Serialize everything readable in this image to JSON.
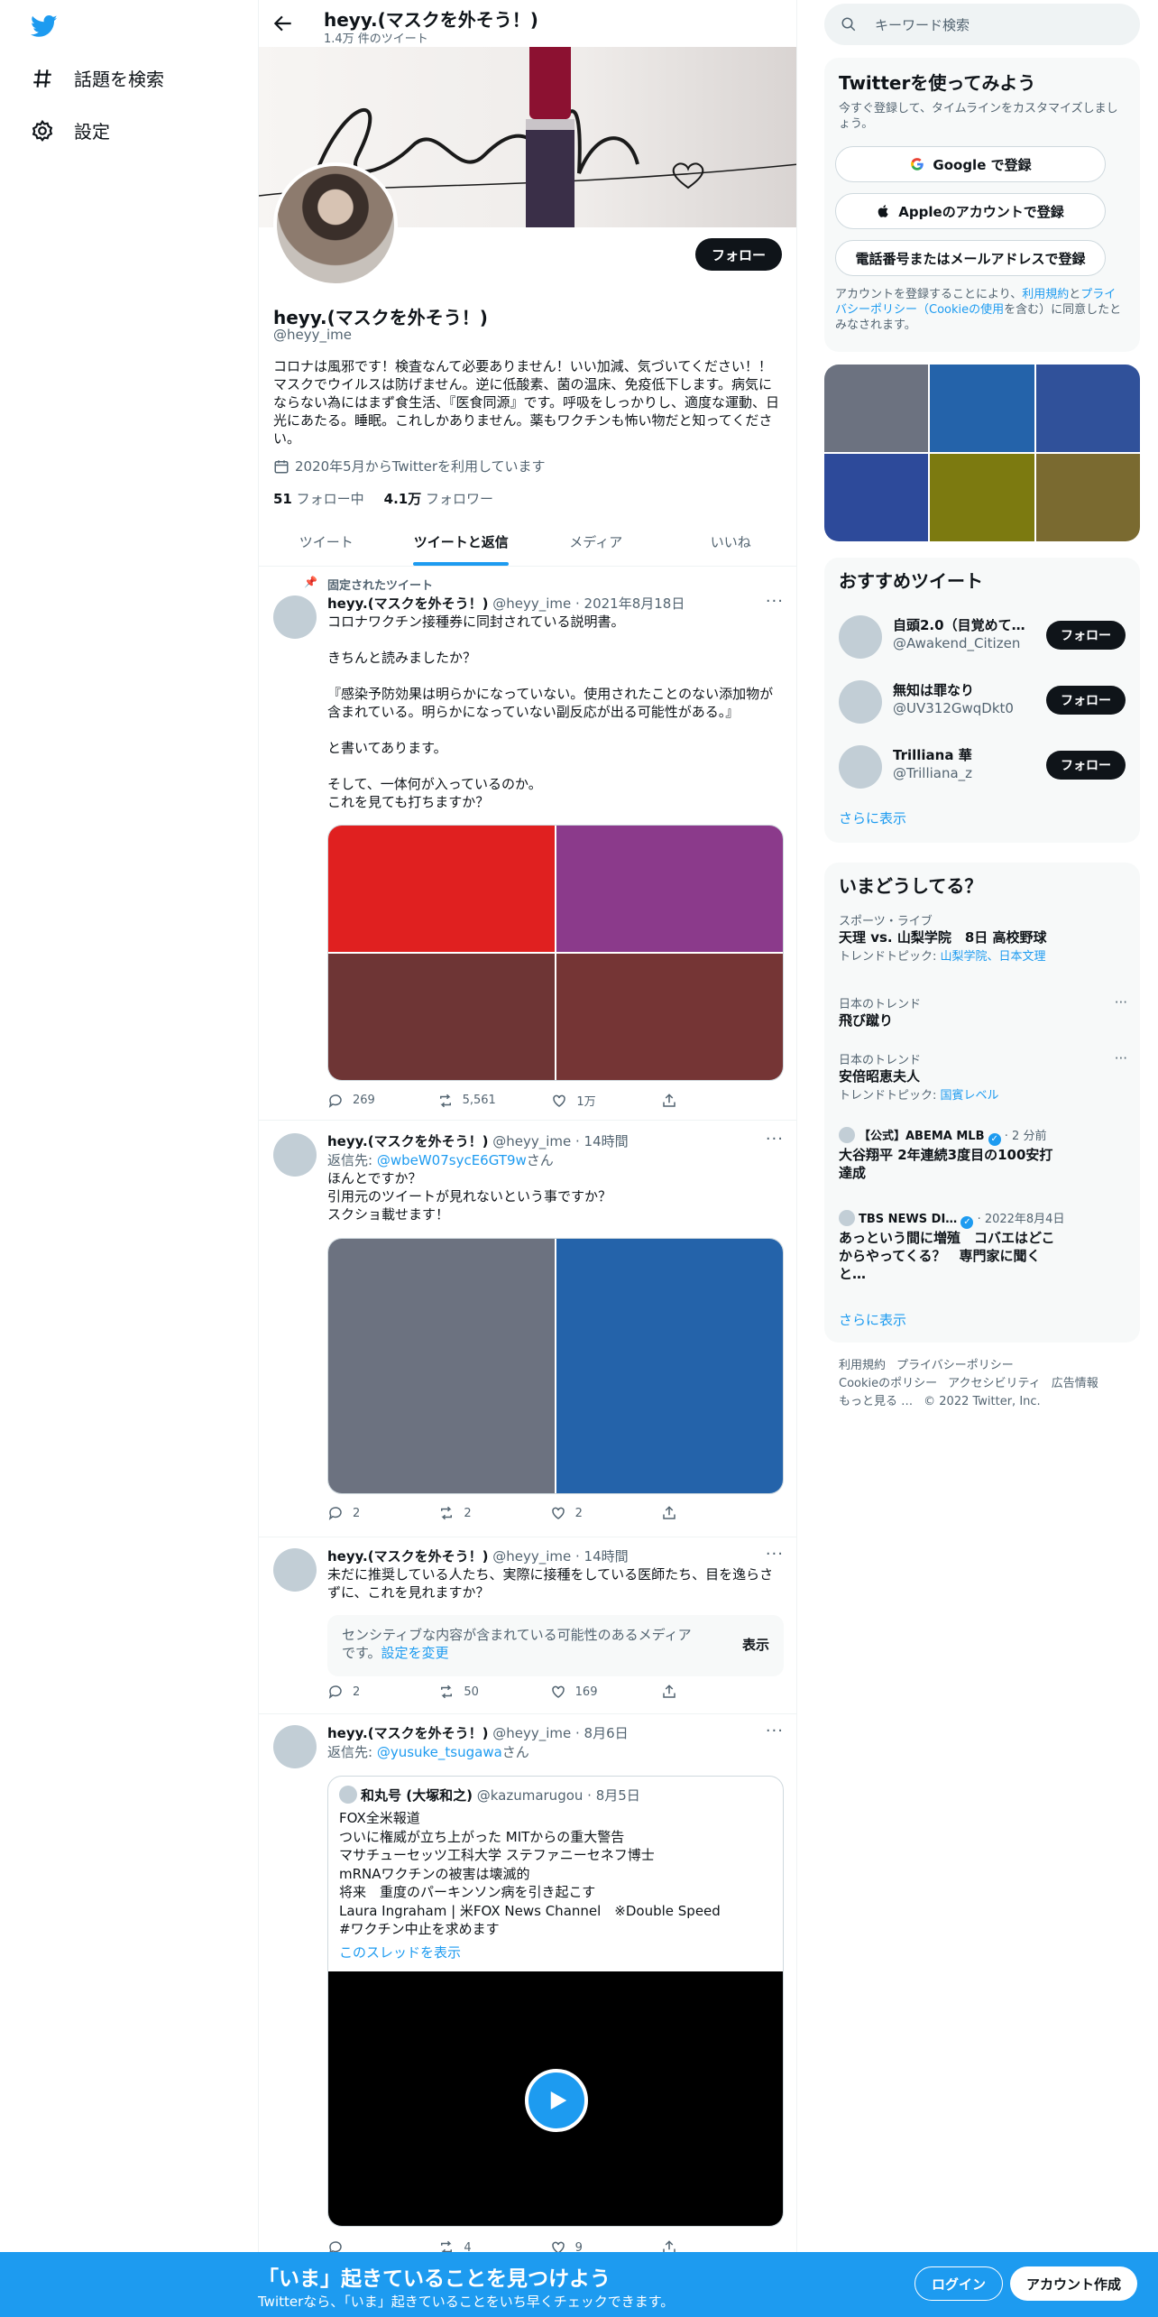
{
  "nav": {
    "explore_label": "話題を検索",
    "settings_label": "設定"
  },
  "header": {
    "title": "heyy.(マスクを外そう！)",
    "tweet_count": "1.4万 件のツイート"
  },
  "profile": {
    "follow_label": "フォロー",
    "name": "heyy.(マスクを外そう！)",
    "handle": "@heyy_ime",
    "bio": "コロナは風邪です！検査なんて必要ありません！いい加減、気づいてください！！マスクでウイルスは防げません。逆に低酸素、菌の温床、免疫低下します。病気にならない為にはまず食生活、『医食同源』です。呼吸をしっかりし、適度な運動、日光にあたる。睡眠。これしかありません。薬もワクチンも怖い物だと知ってください。",
    "joined": "2020年5月からTwitterを利用しています",
    "following_count": "51",
    "following_label": "フォロー中",
    "followers_count": "4.1万",
    "followers_label": "フォロワー"
  },
  "tabs": [
    {
      "label": "ツイート"
    },
    {
      "label": "ツイートと返信"
    },
    {
      "label": "メディア"
    },
    {
      "label": "いいね"
    }
  ],
  "tweets": [
    {
      "pinned_label": "固定されたツイート",
      "name": "heyy.(マスクを外そう！)",
      "meta": "@heyy_ime · 2021年8月18日",
      "text": "コロナワクチン接種券に同封されている説明書。\n\nきちんと読みましたか？\n\n『感染予防効果は明らかになっていない。使用されたことのない添加物が含まれている。明らかになっていない副反応が出る可能性がある。』\n\nと書いてあります。\n\nそして、一体何が入っているのか。\nこれを見ても打ちますか？",
      "media_colors": [
        "#e02020",
        "#8b3a8b",
        "#6e3535",
        "#753535"
      ],
      "replies": "269",
      "retweets": "5,561",
      "likes": "1万"
    },
    {
      "name": "heyy.(マスクを外そう！)",
      "meta": "@heyy_ime · 14時間",
      "reply_prefix": "返信先: ",
      "reply_to": "@wbeW07sycE6GT9w",
      "reply_suffix": "さん",
      "text": "ほんとですか？\n引用元のツイートが見れないという事ですか？\nスクショ載せます！",
      "media_colors": [
        "#6c7280",
        "#2463aa"
      ],
      "replies": "2",
      "retweets": "2",
      "likes": "2"
    },
    {
      "name": "heyy.(マスクを外そう！)",
      "meta": "@heyy_ime · 14時間",
      "text": "未だに推奨している人たち、実際に接種をしている医師たち、目を逸らさずに、これを見れますか？",
      "sensitive_text": "センシティブな内容が含まれている可能性のあるメディアです。",
      "sensitive_link": "設定を変更",
      "sensitive_button": "表示",
      "replies": "2",
      "retweets": "50",
      "likes": "169"
    },
    {
      "name": "heyy.(マスクを外そう！)",
      "meta": "@heyy_ime · 8月6日",
      "reply_prefix": "返信先: ",
      "reply_to": "@yusuke_tsugawa",
      "reply_suffix": "さん",
      "quote_name": "和丸号 (大塚和之)",
      "quote_meta": "@kazumarugou · 8月5日",
      "quote_text": "FOX全米報道\nついに権威が立ち上がった MITからの重大警告\nマサチューセッツ工科大学 ステファニーセネフ博士\nmRNAワクチンの被害は壊滅的\n将来　重度のパーキンソン病を引き起こす\nLaura Ingraham | 米FOX News Channel　※Double Speed\n#ワクチン中止を求めます",
      "quote_link": "このスレッドを表示",
      "retweets": "4",
      "likes": "9"
    }
  ],
  "sidebar": {
    "search_placeholder": "キーワード検索",
    "signup": {
      "title": "Twitterを使ってみよう",
      "subtitle": "今すぐ登録して、タイムラインをカスタマイズしましょう。",
      "google": "Google で登録",
      "apple": "Appleのアカウントで登録",
      "phone": "電話番号またはメールアドレスで登録",
      "legal_1": "アカウントを登録することにより、",
      "legal_terms": "利用規約",
      "legal_2": "と",
      "legal_privacy": "プライバシーポリシー（Cookieの使用",
      "legal_3": "を含む）に同意したとみなされます。"
    },
    "photo_colors": [
      "#6c7280",
      "#2463aa",
      "#30519a",
      "#2d4a9a",
      "#7c7a10",
      "#7a6a30"
    ],
    "recommend": {
      "title": "おすすめツイート",
      "follow_label": "フォロー",
      "items": [
        {
          "name": "自頭2.0（目覚めてる…",
          "handle": "@Awakend_Citizen"
        },
        {
          "name": "無知は罪なり",
          "handle": "@UV312GwqDkt0"
        },
        {
          "name": "Trilliana 華",
          "handle": "@Trilliana_z"
        }
      ],
      "more": "さらに表示"
    },
    "trends": {
      "title": "いまどうしてる？",
      "items": [
        {
          "meta": "スポーツ・ライブ",
          "title": "天理 vs. 山梨学院　8日 高校野球",
          "sub_prefix": "トレンドトピック: ",
          "sub_link": "山梨学院、日本文理"
        },
        {
          "meta": "日本のトレンド",
          "title": "飛び蹴り"
        },
        {
          "meta": "日本のトレンド",
          "title": "安倍昭恵夫人",
          "sub_prefix": "トレンドトピック: ",
          "sub_link": "国賓レベル"
        },
        {
          "meta_source": "【公式】ABEMA MLB",
          "meta_time": "· 2 分前",
          "title": "大谷翔平 2年連続3度目の100安打達成"
        },
        {
          "meta_source": "TBS NEWS DI…",
          "meta_time": "· 2022年8月4日",
          "title": "あっという間に増殖　コバエはどこからやってくる？　専門家に聞くと…"
        }
      ],
      "more": "さらに表示"
    },
    "footer": {
      "terms": "利用規約",
      "privacy": "プライバシーポリシー",
      "cookie": "Cookieのポリシー",
      "accessibility": "アクセシビリティ",
      "ads": "広告情報",
      "more": "もっと見る …",
      "copyright": "© 2022 Twitter, Inc."
    }
  },
  "bottom": {
    "title": "「いま」起きていることを見つけよう",
    "subtitle": "Twitterなら、「いま」起きていることをいち早くチェックできます。",
    "login": "ログイン",
    "signup": "アカウント作成"
  }
}
